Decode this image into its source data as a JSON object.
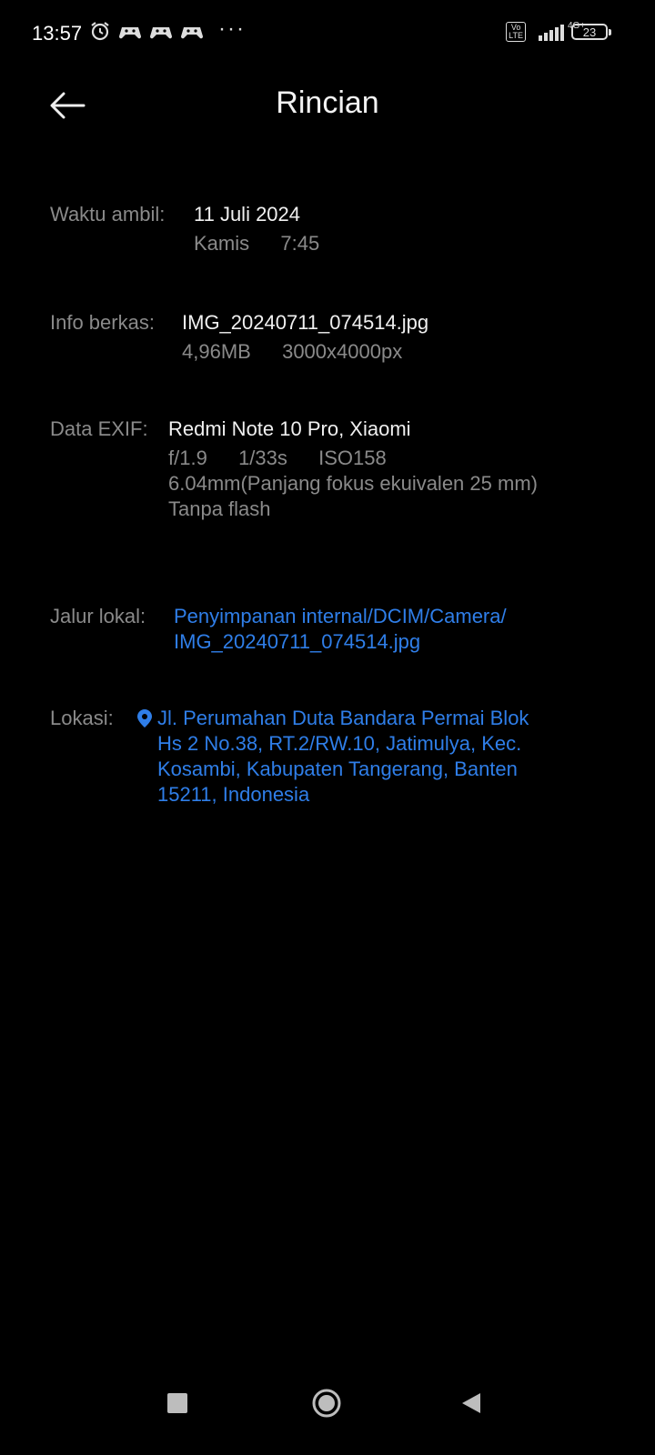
{
  "status_bar": {
    "time": "13:57",
    "more": "···",
    "volte": "Vo\nLTE",
    "network": "4G+",
    "battery": "23"
  },
  "header": {
    "title": "Rincian",
    "back_icon": "arrow-left-icon"
  },
  "details": {
    "taken_time": {
      "label": "Waktu ambil:",
      "date": "11 Juli 2024",
      "day": "Kamis",
      "time": "7:45"
    },
    "file_info": {
      "label": "Info berkas:",
      "name": "IMG_20240711_074514.jpg",
      "size": "4,96MB",
      "resolution": "3000x4000px"
    },
    "exif": {
      "label": "Data EXIF:",
      "device": "Redmi Note 10 Pro, Xiaomi",
      "aperture": "f/1.9",
      "shutter": "1/33s",
      "iso": "ISO158",
      "focal": "6.04mm(Panjang fokus ekuivalen 25 mm)",
      "flash": "Tanpa flash"
    },
    "local_path": {
      "label": "Jalur lokal:",
      "line1": "Penyimpanan internal/DCIM/Camera/",
      "line2": "IMG_20240711_074514.jpg"
    },
    "location": {
      "label": "Lokasi:",
      "line1": "Jl. Perumahan Duta Bandara Permai Blok",
      "line2": "Hs 2 No.38, RT.2/RW.10, Jatimulya, Kec.",
      "line3": "Kosambi, Kabupaten Tangerang, Banten",
      "line4": "15211, Indonesia"
    }
  },
  "colors": {
    "background": "#000000",
    "link": "#2f7ee8",
    "label": "#8a8a8a"
  }
}
